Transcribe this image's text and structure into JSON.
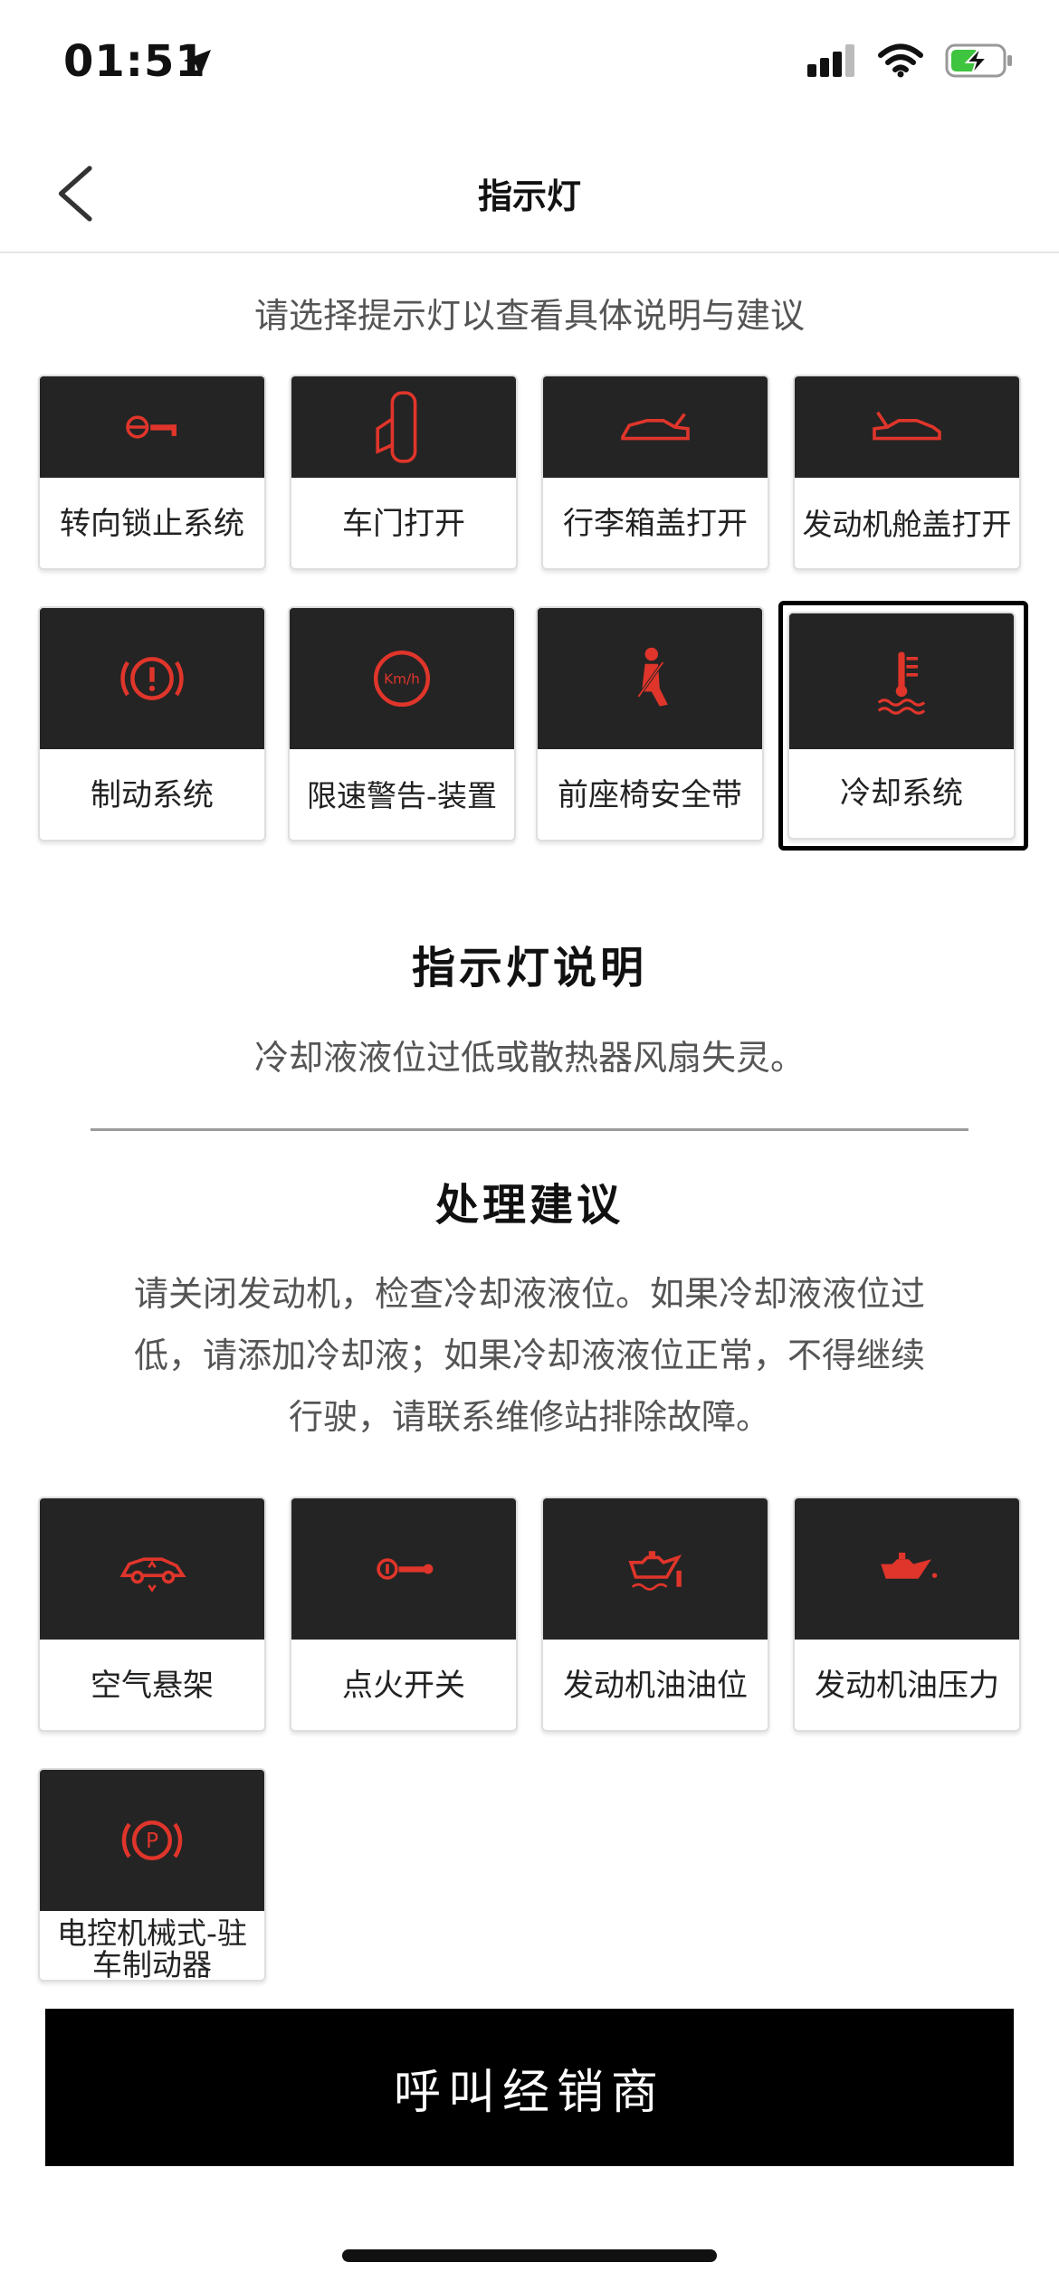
{
  "status_bar": {
    "time": "01:51"
  },
  "nav": {
    "title": "指示灯"
  },
  "hint": "请选择提示灯以查看具体说明与建议",
  "tiles_top": [
    {
      "label": "转向锁止系统",
      "icon": "steering-key-icon"
    },
    {
      "label": "车门打开",
      "icon": "door-open-icon"
    },
    {
      "label": "行李箱盖打开",
      "icon": "trunk-open-icon"
    },
    {
      "label": "发动机舱盖打开",
      "icon": "hood-open-icon"
    }
  ],
  "tiles_mid": [
    {
      "label": "制动系统",
      "icon": "brake-warning-icon"
    },
    {
      "label": "限速警告-装置",
      "icon": "speed-limit-icon",
      "icon_text": "Km/h"
    },
    {
      "label": "前座椅安全带",
      "icon": "seatbelt-icon"
    },
    {
      "label": "冷却系统",
      "icon": "coolant-temperature-icon",
      "selected": true
    }
  ],
  "description": {
    "title": "指示灯说明",
    "text": "冷却液液位过低或散热器风扇失灵。"
  },
  "advice": {
    "title": "处理建议",
    "lines": [
      "请关闭发动机，检查冷却液液位。如果冷却液液位过",
      "低，请添加冷却液；如果冷却液液位正常，不得继续",
      "行驶，请联系维修站排除故障。"
    ]
  },
  "tiles_bottom": [
    {
      "label": "空气悬架",
      "icon": "air-suspension-icon"
    },
    {
      "label": "点火开关",
      "icon": "ignition-key-icon"
    },
    {
      "label": "发动机油油位",
      "icon": "oil-level-icon"
    },
    {
      "label": "发动机油压力",
      "icon": "oil-pressure-icon"
    }
  ],
  "tile_last": {
    "label": "电控机械式-驻车制动器",
    "icon": "parking-brake-icon",
    "icon_text": "P"
  },
  "call_button": "呼叫经销商",
  "colors": {
    "icon_red": "#e0352b",
    "tile_dark": "#242424",
    "button": "#000000"
  }
}
